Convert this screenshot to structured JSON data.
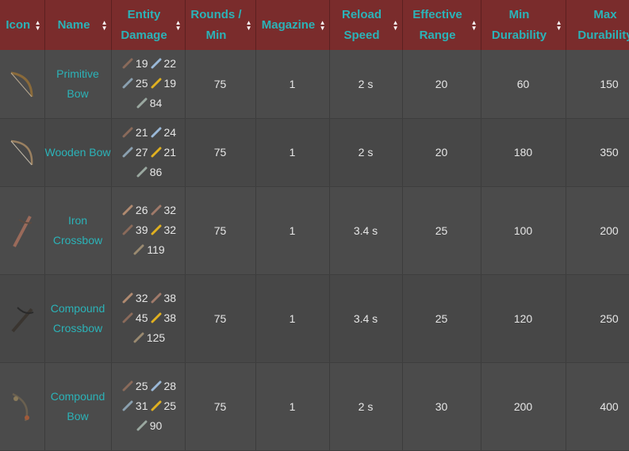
{
  "headers": [
    {
      "key": "icon",
      "label": "Icon"
    },
    {
      "key": "name",
      "label": "Name"
    },
    {
      "key": "damage",
      "label": "Entity Damage"
    },
    {
      "key": "rounds",
      "label": "Rounds / Min"
    },
    {
      "key": "magazine",
      "label": "Magazine"
    },
    {
      "key": "reload",
      "label": "Reload Speed"
    },
    {
      "key": "range",
      "label": "Effective Range"
    },
    {
      "key": "min_dur",
      "label": "Min Durability"
    },
    {
      "key": "max_dur",
      "label": "Max Durability"
    }
  ],
  "sort_glyph": {
    "up": "▲",
    "down": "▼"
  },
  "rows": [
    {
      "icon": "primitive-bow-icon",
      "name": "Primitive Bow",
      "damage": [
        {
          "ammo": "stone-arrow-icon",
          "value": "19"
        },
        {
          "ammo": "iron-arrow-icon",
          "value": "22"
        },
        {
          "ammo": "steel-arrow-icon",
          "value": "25"
        },
        {
          "ammo": "flaming-arrow-icon",
          "value": "19"
        },
        {
          "ammo": "exploding-arrow-icon",
          "value": "84"
        }
      ],
      "rounds": "75",
      "magazine": "1",
      "reload": "2 s",
      "range": "20",
      "min_dur": "60",
      "max_dur": "150",
      "height": 86
    },
    {
      "icon": "wooden-bow-icon",
      "name": "Wooden Bow",
      "damage": [
        {
          "ammo": "stone-arrow-icon",
          "value": "21"
        },
        {
          "ammo": "iron-arrow-icon",
          "value": "24"
        },
        {
          "ammo": "steel-arrow-icon",
          "value": "27"
        },
        {
          "ammo": "flaming-arrow-icon",
          "value": "21"
        },
        {
          "ammo": "exploding-arrow-icon",
          "value": "86"
        }
      ],
      "rounds": "75",
      "magazine": "1",
      "reload": "2 s",
      "range": "20",
      "min_dur": "180",
      "max_dur": "350",
      "height": 86
    },
    {
      "icon": "iron-crossbow-icon",
      "name": "Iron Crossbow",
      "damage": [
        {
          "ammo": "stone-bolt-icon",
          "value": "26"
        },
        {
          "ammo": "iron-bolt-icon",
          "value": "32"
        },
        {
          "ammo": "steel-bolt-icon",
          "value": "39"
        },
        {
          "ammo": "flaming-bolt-icon",
          "value": "32"
        },
        {
          "ammo": "exploding-bolt-icon",
          "value": "119"
        }
      ],
      "rounds": "75",
      "magazine": "1",
      "reload": "3.4 s",
      "range": "25",
      "min_dur": "100",
      "max_dur": "200",
      "height": 111
    },
    {
      "icon": "compound-crossbow-icon",
      "name": "Compound Crossbow",
      "damage": [
        {
          "ammo": "stone-bolt-icon",
          "value": "32"
        },
        {
          "ammo": "iron-bolt-icon",
          "value": "38"
        },
        {
          "ammo": "steel-bolt-icon",
          "value": "45"
        },
        {
          "ammo": "flaming-bolt-icon",
          "value": "38"
        },
        {
          "ammo": "exploding-bolt-icon",
          "value": "125"
        }
      ],
      "rounds": "75",
      "magazine": "1",
      "reload": "3.4 s",
      "range": "25",
      "min_dur": "120",
      "max_dur": "250",
      "height": 111
    },
    {
      "icon": "compound-bow-icon",
      "name": "Compound Bow",
      "damage": [
        {
          "ammo": "stone-arrow-icon",
          "value": "25"
        },
        {
          "ammo": "iron-arrow-icon",
          "value": "28"
        },
        {
          "ammo": "steel-arrow-icon",
          "value": "31"
        },
        {
          "ammo": "flaming-arrow-icon",
          "value": "25"
        },
        {
          "ammo": "exploding-arrow-icon",
          "value": "90"
        }
      ],
      "rounds": "75",
      "magazine": "1",
      "reload": "2 s",
      "range": "30",
      "min_dur": "200",
      "max_dur": "400",
      "height": 111
    }
  ]
}
